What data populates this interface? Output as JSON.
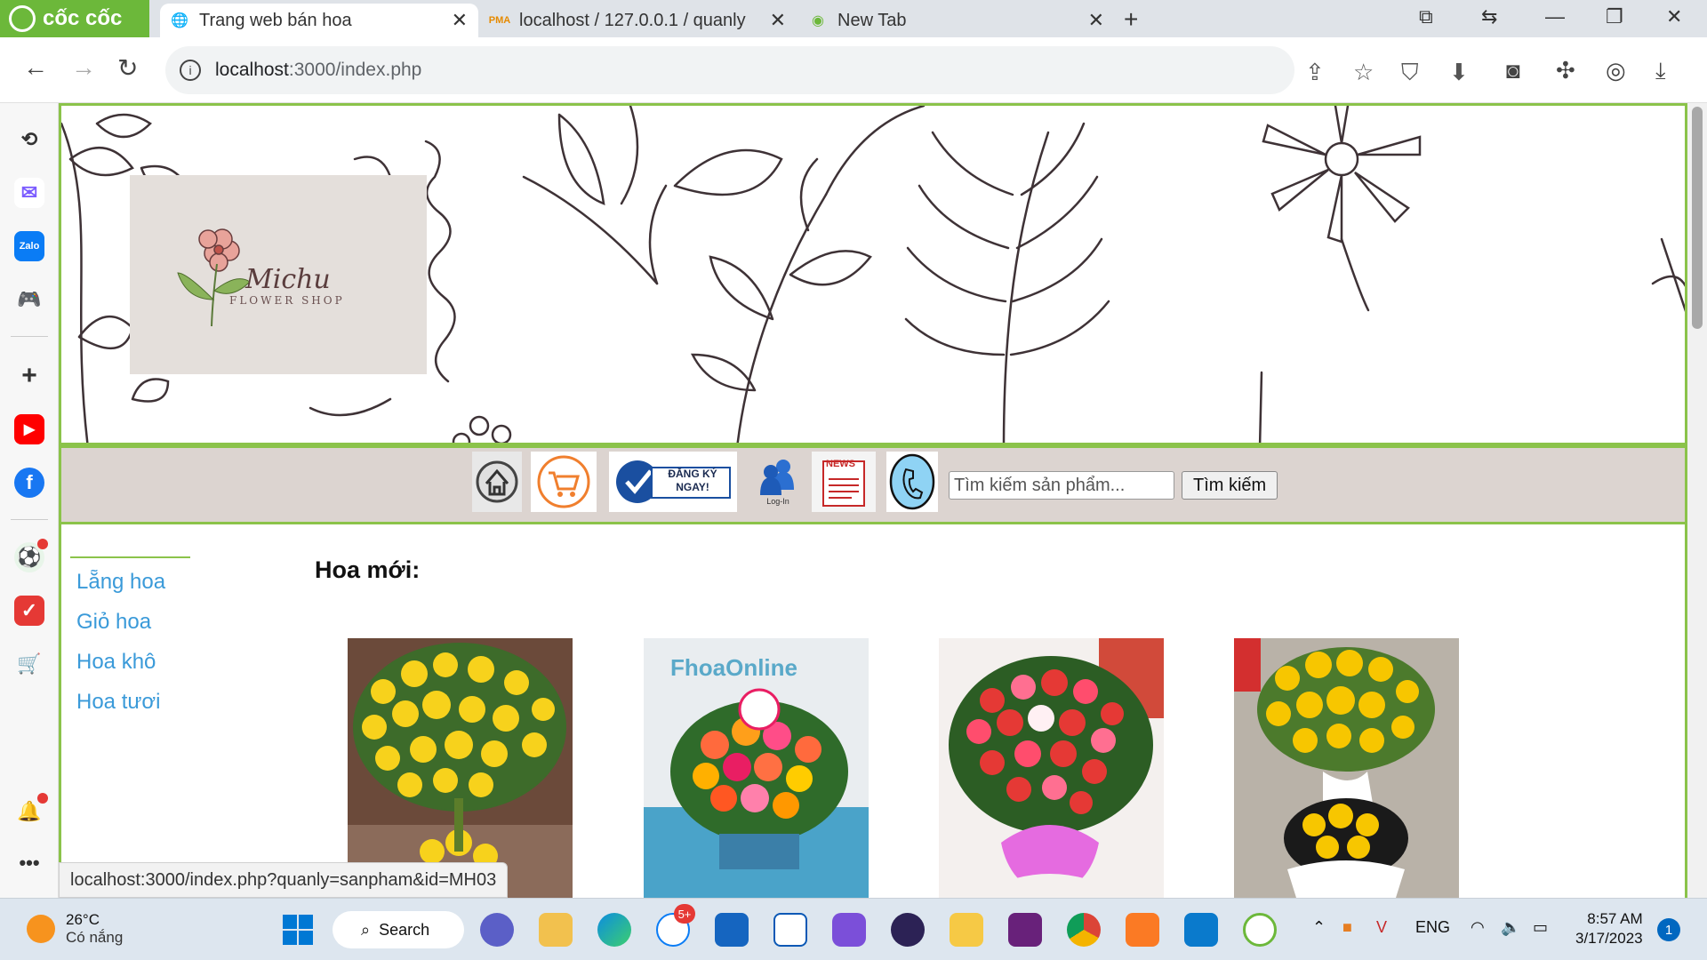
{
  "browser": {
    "brand": "cốc cốc",
    "tabs": [
      {
        "title": "Trang web bán hoa"
      },
      {
        "title": "localhost / 127.0.0.1 / quanly"
      },
      {
        "title": "New Tab"
      }
    ],
    "url_host": "localhost",
    "url_path": ":3000/index.php",
    "status_url": "localhost:3000/index.php?quanly=sanpham&id=MH03"
  },
  "sidebar": {
    "icons": [
      "history-icon",
      "messenger-icon",
      "zalo-icon",
      "game-icon",
      "add-icon",
      "youtube-icon",
      "facebook-icon",
      "soccer-icon",
      "todo-icon",
      "shopping-icon",
      "bell-icon",
      "more-icon"
    ]
  },
  "logo": {
    "script": "Michu",
    "sub": "FLOWER SHOP"
  },
  "menu": {
    "register_line1": "ĐĂNG KÝ",
    "register_line2": "NGAY!",
    "login_caption": "Log-In",
    "news_label": "NEWS",
    "search_placeholder": "Tìm kiếm sản phẩm...",
    "search_button": "Tìm kiếm"
  },
  "categories": [
    "Lẵng hoa",
    "Giỏ hoa",
    "Hoa khô",
    "Hoa tươi"
  ],
  "new_heading": "Hoa mới:",
  "products": [
    {
      "image": "yellow-lily-flower-stand"
    },
    {
      "image": "colorful-gerbera-basket",
      "banner_text": "FhoaOnline"
    },
    {
      "image": "red-gerbera-flower-stand"
    },
    {
      "image": "yellow-daisy-flower-stand"
    }
  ],
  "taskbar": {
    "temperature": "26°C",
    "weather": "Có nắng",
    "search_label": "Search",
    "zalo_badge": "5+",
    "lang": "ENG",
    "time": "8:57 AM",
    "date": "3/17/2023",
    "notification_count": "1"
  },
  "colors": {
    "accent_green": "#8bc34a",
    "link_blue": "#3a9ad9",
    "menu_bg": "#dcd4d0",
    "brand_green": "#6cb83a"
  }
}
